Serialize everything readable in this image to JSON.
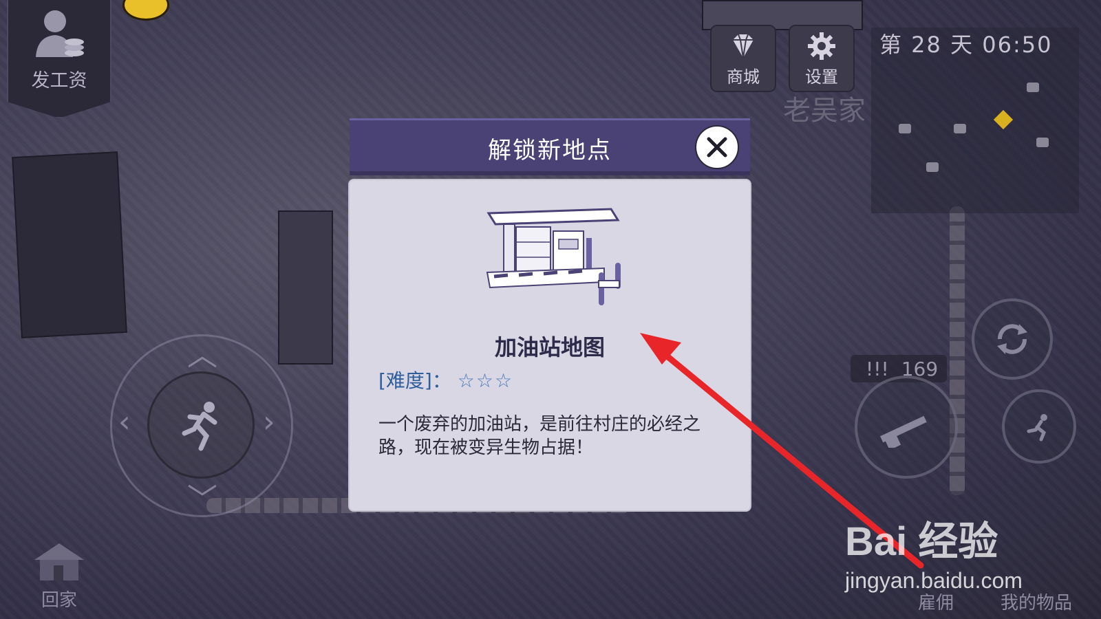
{
  "hud": {
    "salary_label": "发工资",
    "shop_label": "商城",
    "settings_label": "设置",
    "day_time": "第 28 天  06:50",
    "location_sign": "老吴家",
    "ammo_count": "169",
    "ammo_indicator": "!!!",
    "home_label": "回家",
    "hire_label": "雇佣",
    "items_label": "我的物品"
  },
  "modal": {
    "title": "解锁新地点",
    "map_name": "加油站地图",
    "difficulty_label": "[难度]：",
    "difficulty_stars": "☆☆☆",
    "description": "一个废弃的加油站，是前往村庄的必经之路，现在被变异生物占据！"
  },
  "watermark": {
    "brand": "Bai  经验",
    "url": "jingyan.baidu.com"
  },
  "colors": {
    "modal_header": "#4a4274",
    "modal_body": "#d9d7e3",
    "arrow": "#e8262a"
  }
}
